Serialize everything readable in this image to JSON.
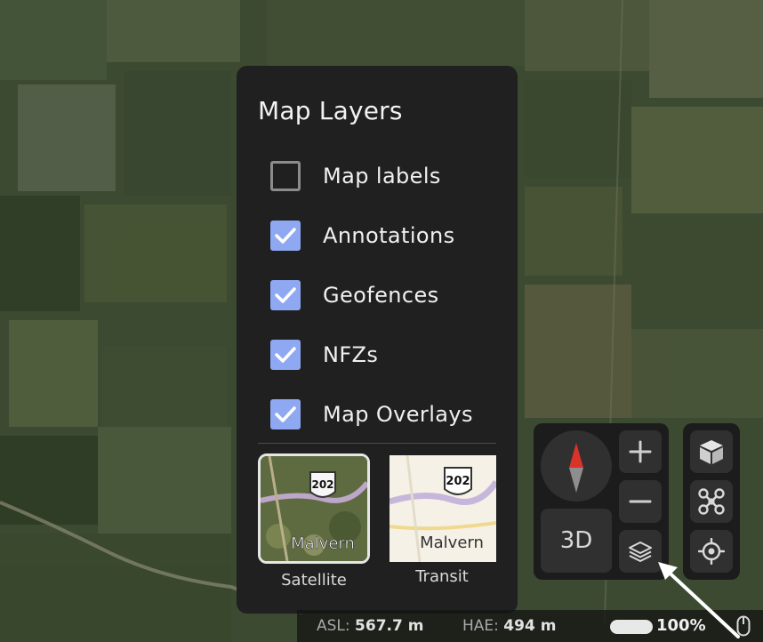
{
  "panel": {
    "title": "Map Layers",
    "layers": [
      {
        "label": "Map labels",
        "checked": false
      },
      {
        "label": "Annotations",
        "checked": true
      },
      {
        "label": "Geofences",
        "checked": true
      },
      {
        "label": "NFZs",
        "checked": true
      },
      {
        "label": "Map Overlays",
        "checked": true
      }
    ],
    "basemaps": [
      {
        "label": "Satellite",
        "selected": true,
        "shield": "202",
        "town": "Malvern"
      },
      {
        "label": "Transit",
        "selected": false,
        "shield": "202",
        "town": "Malvern"
      }
    ]
  },
  "controls": {
    "mode_3d": "3D",
    "icons": [
      "compass-icon",
      "zoom-in-icon",
      "zoom-out-icon",
      "layers-icon",
      "cube-icon",
      "drone-icon",
      "locate-icon"
    ]
  },
  "status": {
    "asl_label": "ASL:",
    "asl_value": "567.7 m",
    "hae_label": "HAE:",
    "hae_value": "494 m",
    "zoom": "100%"
  },
  "colors": {
    "checkbox_on": "#8fa8f2",
    "panel_bg": "#202020",
    "compass_north": "#d9332a"
  }
}
